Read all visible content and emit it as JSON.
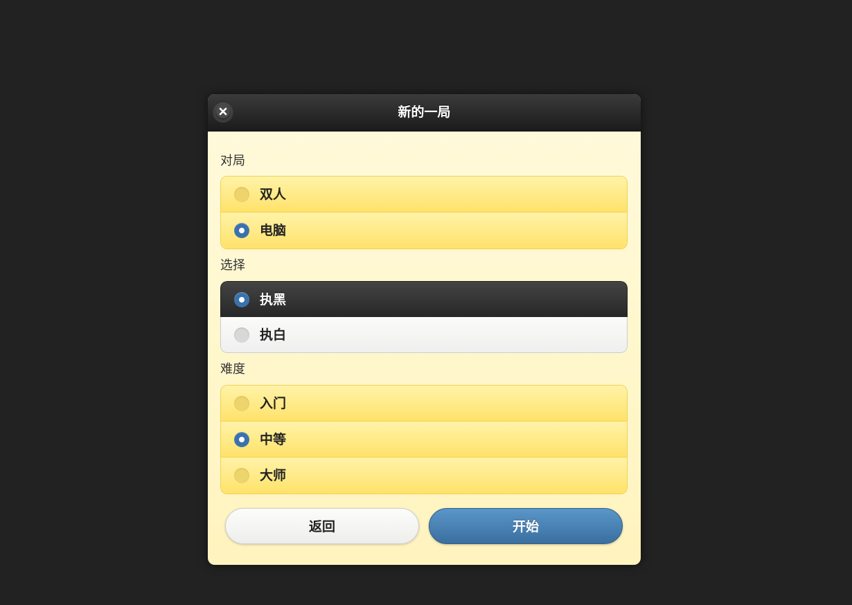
{
  "dialog": {
    "title": "新的一局",
    "close_icon": "close-icon"
  },
  "sections": {
    "mode": {
      "label": "对局",
      "options": [
        {
          "label": "双人",
          "selected": false
        },
        {
          "label": "电脑",
          "selected": true
        }
      ]
    },
    "side": {
      "label": "选择",
      "options": [
        {
          "label": "执黑",
          "selected": true
        },
        {
          "label": "执白",
          "selected": false
        }
      ]
    },
    "difficulty": {
      "label": "难度",
      "options": [
        {
          "label": "入门",
          "selected": false
        },
        {
          "label": "中等",
          "selected": true
        },
        {
          "label": "大师",
          "selected": false
        }
      ]
    }
  },
  "buttons": {
    "back_label": "返回",
    "start_label": "开始"
  },
  "colors": {
    "background": "#222222",
    "dialog_body": "#fff8d0",
    "accent_blue": "#3a72ac",
    "option_yellow": "#ffe26a"
  }
}
